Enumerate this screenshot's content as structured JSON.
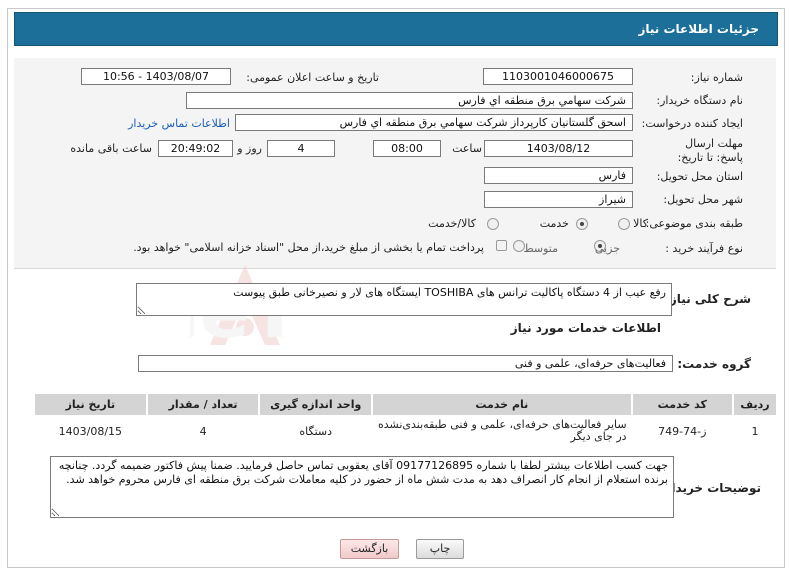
{
  "header": {
    "title": "جزئیات اطلاعات نیاز"
  },
  "form": {
    "need_number": {
      "label": "شماره نیاز:",
      "value": "1103001046000675"
    },
    "announce_datetime": {
      "label": "تاریخ و ساعت اعلان عمومی:",
      "value": "1403/08/07 - 10:56"
    },
    "buyer_org": {
      "label": "نام دستگاه خریدار:",
      "value": "شرکت سهامي برق منطقه اي فارس"
    },
    "requester": {
      "label": "ایجاد کننده درخواست:",
      "value": "اسحق گلستانيان کارپرداز شرکت سهامي برق منطقه اي فارس",
      "contact_link": "اطلاعات تماس خریدار"
    },
    "deadline": {
      "label": "مهلت ارسال پاسخ: تا تاریخ:",
      "date": "1403/08/12",
      "time_label": "ساعت",
      "time": "08:00",
      "days": "4",
      "days_label": "روز و",
      "remaining": "20:49:02",
      "remaining_label": "ساعت باقی مانده"
    },
    "province": {
      "label": "استان محل تحویل:",
      "value": "فارس"
    },
    "city": {
      "label": "شهر محل تحویل:",
      "value": "شیراز"
    },
    "category": {
      "label": "طبقه بندی موضوعی:",
      "options": [
        "کالا",
        "خدمت",
        "کالا/خدمت"
      ],
      "selected": "خدمت"
    },
    "process": {
      "label": "نوع فرآیند خرید :",
      "options": [
        "جزیی",
        "متوسط"
      ],
      "selected": "جزیی",
      "payment_note": "پرداخت تمام یا بخشی از مبلغ خرید،از محل \"اسناد خزانه اسلامی\" خواهد بود."
    }
  },
  "summary": {
    "label": "شرح کلی نیاز:",
    "value": "رفع عیب از 4 دستگاه پاکالیت ترانس های TOSHIBA ایستگاه های لار و نصیرخانی طبق پیوست"
  },
  "services": {
    "section_title": "اطلاعات خدمات مورد نیاز",
    "group_label": "گروه خدمت:",
    "group_value": "فعالیت‌های حرفه‌ای، علمی و فنی",
    "columns": [
      "ردیف",
      "کد خدمت",
      "نام خدمت",
      "واحد اندازه گیری",
      "تعداد / مقدار",
      "تاریخ نیاز"
    ],
    "rows": [
      {
        "row": "1",
        "code": "ز-74-749",
        "name": "سایر فعالیت‌های حرفه‌ای، علمی و فنی طبقه‌بندی‌نشده در جای دیگر",
        "unit": "دستگاه",
        "qty": "4",
        "date": "1403/08/15"
      }
    ]
  },
  "buyer_notes": {
    "label": "توضیحات خریدار:",
    "value": "جهت کسب اطلاعات بیشتر لطفا با شماره 09177126895 آقای یعقوبی تماس حاصل فرمایید. ضمنا پیش فاکتور ضمیمه گردد. چنانچه برنده استعلام از انجام کار انصراف دهد به مدت شش ماه از حضور در کلیه معاملات شرکت برق منطقه ای فارس محروم خواهد شد."
  },
  "buttons": {
    "print": "چاپ",
    "back": "بازگشت"
  },
  "watermark": "AriaTender.neT"
}
